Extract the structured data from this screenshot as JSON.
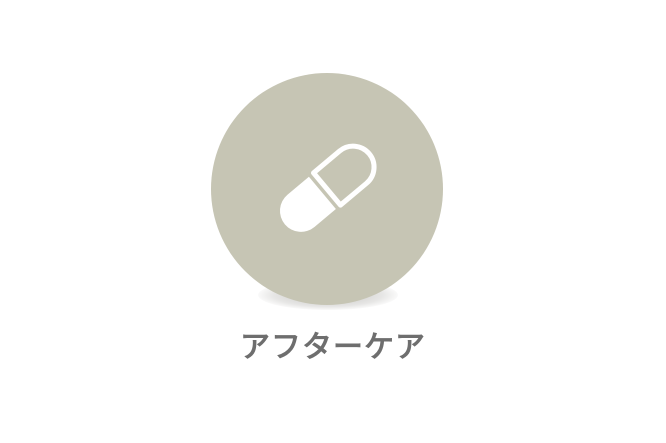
{
  "aftercare_tile": {
    "label": "アフターケア",
    "icon": "pill-capsule-icon",
    "circle_color": "#c6c5b4",
    "icon_color": "#ffffff",
    "label_color": "#6e6e6e"
  }
}
